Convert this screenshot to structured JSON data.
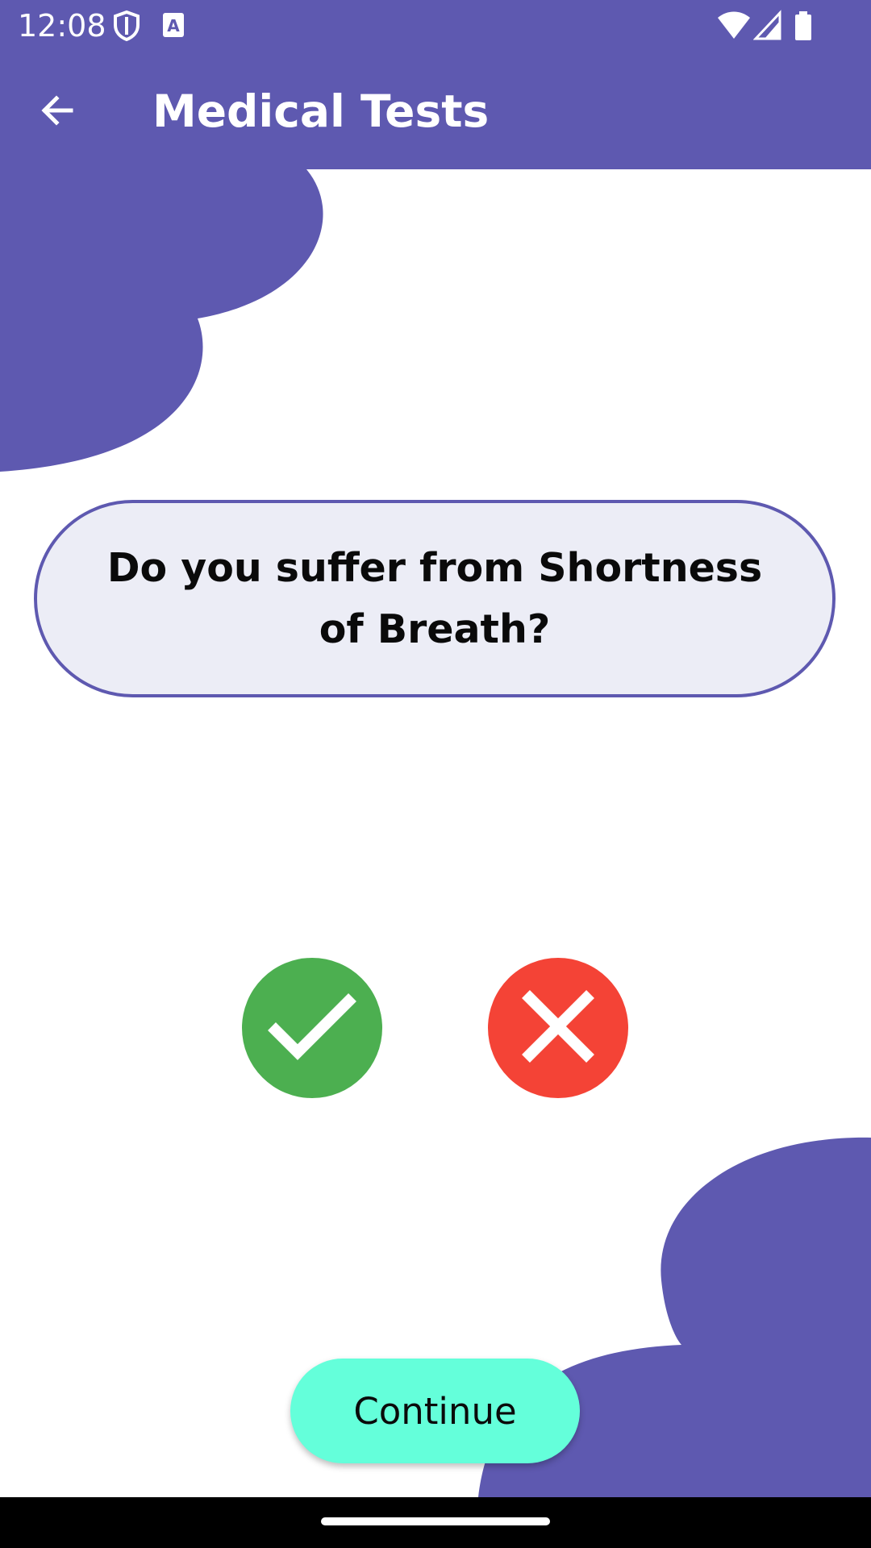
{
  "status_bar": {
    "time": "12:08",
    "icons": [
      "shield-icon",
      "text-recognition-icon",
      "wifi-icon",
      "signal-icon",
      "battery-icon"
    ]
  },
  "app_bar": {
    "title": "Medical Tests",
    "back_icon": "arrow-back-icon"
  },
  "question": {
    "text": "Do you suffer from Shortness of Breath?"
  },
  "answers": {
    "yes_icon": "check-icon",
    "no_icon": "close-icon"
  },
  "footer": {
    "continue_label": "Continue"
  },
  "colors": {
    "primary": "#5e59b0",
    "question_bg": "#ecedf6",
    "yes": "#4caf50",
    "no": "#f44336",
    "continue_bg": "#64ffda"
  }
}
